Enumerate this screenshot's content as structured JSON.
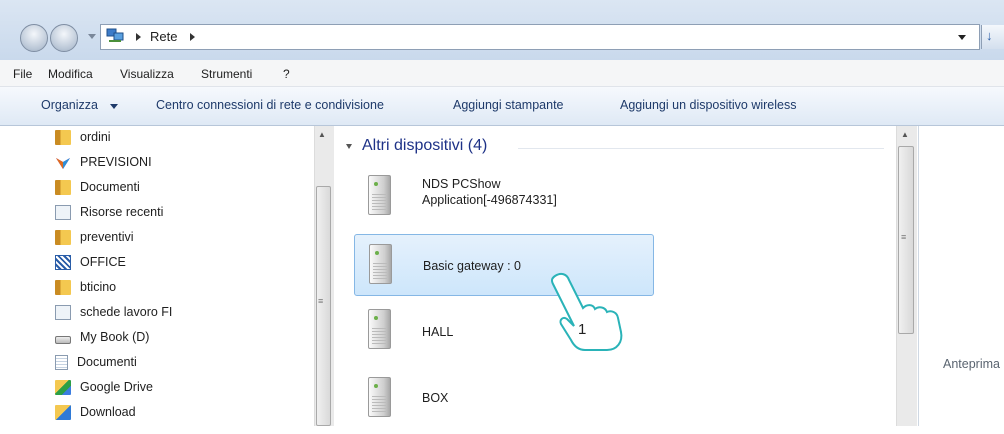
{
  "address": {
    "crumb": "Rete",
    "separator": "▸",
    "refresh_glyph": "↓"
  },
  "menu": [
    "File",
    "Modifica",
    "Visualizza",
    "Strumenti",
    "?"
  ],
  "toolbar": {
    "organize": "Organizza",
    "network_center": "Centro connessioni di rete e condivisione",
    "add_printer": "Aggiungi stampante",
    "add_wireless": "Aggiungi un dispositivo wireless"
  },
  "nav": {
    "items": [
      {
        "label": "ordini",
        "icon": "folder-icon"
      },
      {
        "label": "PREVISIONI",
        "icon": "app-icon"
      },
      {
        "label": "Documenti",
        "icon": "folder-icon"
      },
      {
        "label": "Risorse recenti",
        "icon": "recent-places-icon"
      },
      {
        "label": "preventivi",
        "icon": "folder-icon"
      },
      {
        "label": "OFFICE",
        "icon": "office-shortcut-icon"
      },
      {
        "label": "bticino",
        "icon": "folder-icon"
      },
      {
        "label": "schede lavoro FI",
        "icon": "recent-places-icon"
      },
      {
        "label": "My Book (D)",
        "icon": "drive-icon"
      },
      {
        "label": "Documenti",
        "icon": "document-icon"
      },
      {
        "label": "Google Drive",
        "icon": "google-drive-folder-icon"
      },
      {
        "label": "Download",
        "icon": "download-folder-icon"
      }
    ]
  },
  "content": {
    "group_title": "Altri dispositivi (4)",
    "devices": [
      {
        "line1": "NDS PCShow",
        "line2": "Application[-496874331]",
        "selected": false
      },
      {
        "line1": "Basic gateway : 0",
        "line2": "",
        "selected": true
      },
      {
        "line1": "HALL",
        "line2": "",
        "selected": false
      },
      {
        "line1": "BOX",
        "line2": "",
        "selected": false
      }
    ]
  },
  "preview": {
    "text": "Anteprima"
  },
  "annotation": {
    "label": "1"
  },
  "colors": {
    "accent": "#1e3287",
    "selection": "#cde6fb",
    "annotation": "#2ab3b8"
  }
}
